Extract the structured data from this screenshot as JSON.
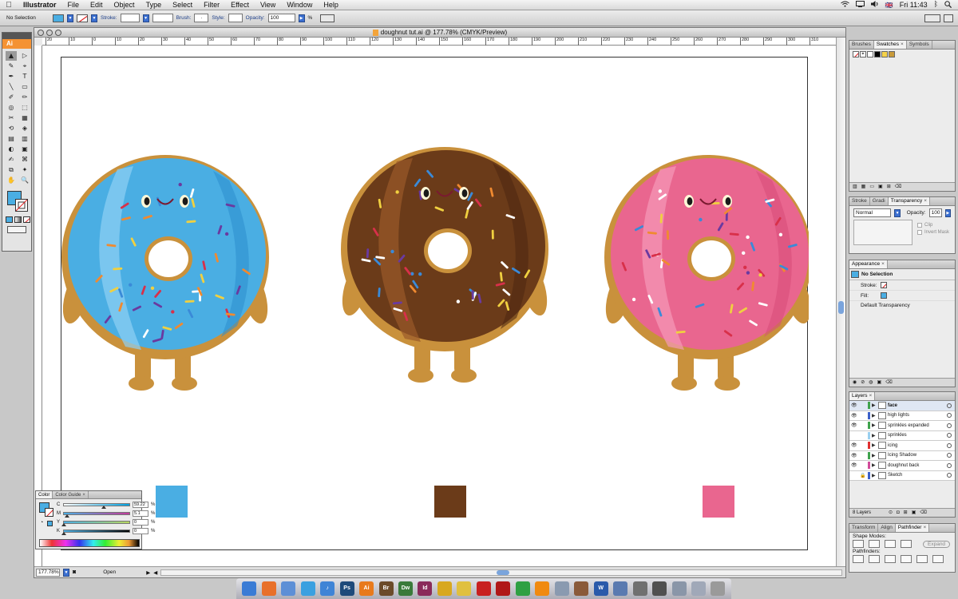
{
  "menubar": {
    "apple_icon": "apple-icon",
    "items": [
      "Illustrator",
      "File",
      "Edit",
      "Object",
      "Type",
      "Select",
      "Filter",
      "Effect",
      "View",
      "Window",
      "Help"
    ],
    "flag": "🇬🇧",
    "clock": "Fri 11:43"
  },
  "controlbar": {
    "selection_label": "No Selection",
    "stroke_label": "Stroke:",
    "brush_label": "Brush:",
    "style_label": "Style:",
    "opacity_label": "Opacity:",
    "opacity_value": "100",
    "opacity_unit": "%",
    "fill_color": "#4aaee3"
  },
  "document": {
    "title": "doughnut tut.ai @ 177.78% (CMYK/Preview)",
    "ruler_ticks": [
      "20",
      "10",
      "0",
      "10",
      "20",
      "30",
      "40",
      "50",
      "60",
      "70",
      "80",
      "90",
      "100",
      "110",
      "120",
      "130",
      "140",
      "150",
      "160",
      "170",
      "180",
      "190",
      "200",
      "210",
      "220",
      "230",
      "240",
      "250",
      "260",
      "270",
      "280",
      "290",
      "300",
      "310"
    ],
    "zoom": "177.78%",
    "status": "Open",
    "swatches": [
      "#4aaee3",
      "#6b3b19",
      "#e9668f"
    ]
  },
  "tools_panel": {
    "logo": "Ai",
    "tools": [
      "▲",
      "▷",
      "✎",
      "⌖",
      "✒",
      "T",
      "╲",
      "▭",
      "✐",
      "✏",
      "◎",
      "⬚",
      "✂",
      "▦",
      "⟲",
      "◈",
      "▤",
      "▥",
      "◐",
      "▣",
      "✍",
      "⌘",
      "⧉",
      "✦",
      "✋",
      "🔍"
    ],
    "fill_color": "#4aaee3"
  },
  "swatches_panel": {
    "tabs": [
      "Brushes",
      "Swatches",
      "Symbols"
    ],
    "active": "Swatches",
    "colors": [
      "#ffffff",
      "#000000",
      "#f5d24a",
      "#c89a3a"
    ]
  },
  "transparency_panel": {
    "tabs": [
      "Stroke",
      "Gradi",
      "Transparency"
    ],
    "active": "Transparency",
    "blend_mode": "Normal",
    "opacity_label": "Opacity:",
    "opacity_value": "100",
    "clip_label": "Clip",
    "invert_label": "Invert Mask"
  },
  "appearance_panel": {
    "tab": "Appearance",
    "selection": "No Selection",
    "stroke_label": "Stroke:",
    "fill_label": "Fill:",
    "default_label": "Default Transparency"
  },
  "layers_panel": {
    "tab": "Layers",
    "layers": [
      {
        "name": "face",
        "color": "#3fa34d",
        "visible": true,
        "locked": false
      },
      {
        "name": "high lights",
        "color": "#3b60c9",
        "visible": true,
        "locked": false
      },
      {
        "name": "sprinkles expanded",
        "color": "#3fa34d",
        "visible": true,
        "locked": false
      },
      {
        "name": "sprinkles",
        "color": "#9ad0f0",
        "visible": false,
        "locked": false
      },
      {
        "name": "icing",
        "color": "#e03030",
        "visible": true,
        "locked": false
      },
      {
        "name": "Icing Shadow",
        "color": "#3fa34d",
        "visible": true,
        "locked": false
      },
      {
        "name": "doughnut back",
        "color": "#d24b9a",
        "visible": true,
        "locked": false
      },
      {
        "name": "Sketch",
        "color": "#3b60c9",
        "visible": false,
        "locked": true
      }
    ],
    "footer": "8 Layers"
  },
  "pathfinder_panel": {
    "tabs": [
      "Transform",
      "Align",
      "Pathfinder"
    ],
    "active": "Pathfinder",
    "shape_modes_label": "Shape Modes:",
    "pathfinders_label": "Pathfinders:",
    "expand_label": "Expand"
  },
  "color_panel": {
    "tabs": [
      "Color",
      "Color Guide"
    ],
    "active": "Color",
    "fill_color": "#4aaee3",
    "channels": [
      {
        "label": "C",
        "value": "59.22",
        "fraction": 0.5922
      },
      {
        "label": "M",
        "value": "5.1",
        "fraction": 0.051
      },
      {
        "label": "Y",
        "value": "0",
        "fraction": 0
      },
      {
        "label": "K",
        "value": "0",
        "fraction": 0
      }
    ],
    "unit": "%"
  },
  "dock": {
    "apps": [
      {
        "name": "finder-icon",
        "label": "",
        "color": "#3a7bd5"
      },
      {
        "name": "firefox-icon",
        "label": "",
        "color": "#e8702a"
      },
      {
        "name": "preview-icon",
        "label": "",
        "color": "#5d8fd6"
      },
      {
        "name": "safari-icon",
        "label": "",
        "color": "#3aa0e0"
      },
      {
        "name": "itunes-icon",
        "label": "♪",
        "color": "#3f84d6"
      },
      {
        "name": "photoshop-icon",
        "label": "Ps",
        "color": "#1e4a7a"
      },
      {
        "name": "illustrator-icon",
        "label": "Ai",
        "color": "#e87a1c"
      },
      {
        "name": "bridge-icon",
        "label": "Br",
        "color": "#6b4b2a"
      },
      {
        "name": "dreamweaver-icon",
        "label": "Dw",
        "color": "#3a7a3a"
      },
      {
        "name": "indesign-icon",
        "label": "Id",
        "color": "#8a2a5a"
      },
      {
        "name": "app-icon-1",
        "label": "",
        "color": "#d8a820"
      },
      {
        "name": "app-icon-2",
        "label": "",
        "color": "#e0c040"
      },
      {
        "name": "acrobat-icon",
        "label": "",
        "color": "#c82020"
      },
      {
        "name": "acrobat-pro-icon",
        "label": "",
        "color": "#b01818"
      },
      {
        "name": "spotify-icon",
        "label": "",
        "color": "#2ea043"
      },
      {
        "name": "vlc-icon",
        "label": "",
        "color": "#f08a10"
      },
      {
        "name": "mail-icon",
        "label": "",
        "color": "#8a9ab0"
      },
      {
        "name": "photo-icon",
        "label": "",
        "color": "#8a5a3a"
      },
      {
        "name": "word-icon",
        "label": "W",
        "color": "#2a5aaa"
      },
      {
        "name": "books-icon",
        "label": "",
        "color": "#5a7ab0"
      },
      {
        "name": "app-icon-3",
        "label": "",
        "color": "#707070"
      },
      {
        "name": "app-icon-4",
        "label": "",
        "color": "#505050"
      },
      {
        "name": "downloads-icon",
        "label": "",
        "color": "#8a96a8"
      },
      {
        "name": "folder-icon",
        "label": "",
        "color": "#a0a8b8"
      },
      {
        "name": "trash-icon",
        "label": "",
        "color": "#9a9a9a"
      }
    ]
  }
}
